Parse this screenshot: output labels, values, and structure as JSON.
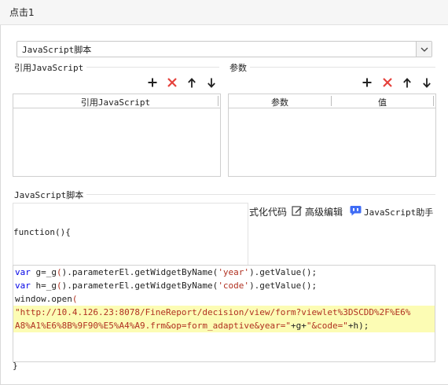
{
  "window": {
    "title": "点击1"
  },
  "script_type": {
    "selected": "JavaScript脚本"
  },
  "ref_js": {
    "label": "引用JavaScript",
    "column_header": "引用JavaScript"
  },
  "params": {
    "label": "参数",
    "col_param": "参数",
    "col_value": "值"
  },
  "js_section": {
    "label": "JavaScript脚本"
  },
  "editor_tools": {
    "format": "式化代码",
    "advanced": "高级编辑",
    "assistant": "JavaScript助手"
  },
  "code": {
    "header": "function(){",
    "lines": [
      {
        "kw": "var",
        "a": " g=_g",
        "p1": "(",
        "b": ").parameterEl.getWidgetByName(",
        "s": "'year'",
        "c": ").getValue();"
      },
      {
        "kw": "var",
        "a": " h=_g",
        "p1": "(",
        "b": ").parameterEl.getWidgetByName(",
        "s": "'code'",
        "c": ").getValue();"
      }
    ],
    "open_prefix": "window.open",
    "open_paren": "(",
    "url_line1": "\"http://10.4.126.23:8078/FineReport/decision/view/form?viewlet%3DSCDD%2F%E6%",
    "url_line2": "A8%A1%E6%8B%9F90%E5%A4%A9.frm&op=form_adaptive&year=\"",
    "url_tail_1": "+g+",
    "url_tail_2": "\"&code=\"",
    "url_tail_3": "+h);",
    "footer": "}"
  },
  "colors": {
    "add": "#222222",
    "delete": "#e5413b",
    "assistant": "#3f6cf5",
    "keyword": "#0000e6",
    "string": "#b03020",
    "highlight": "#fcfcb4"
  }
}
